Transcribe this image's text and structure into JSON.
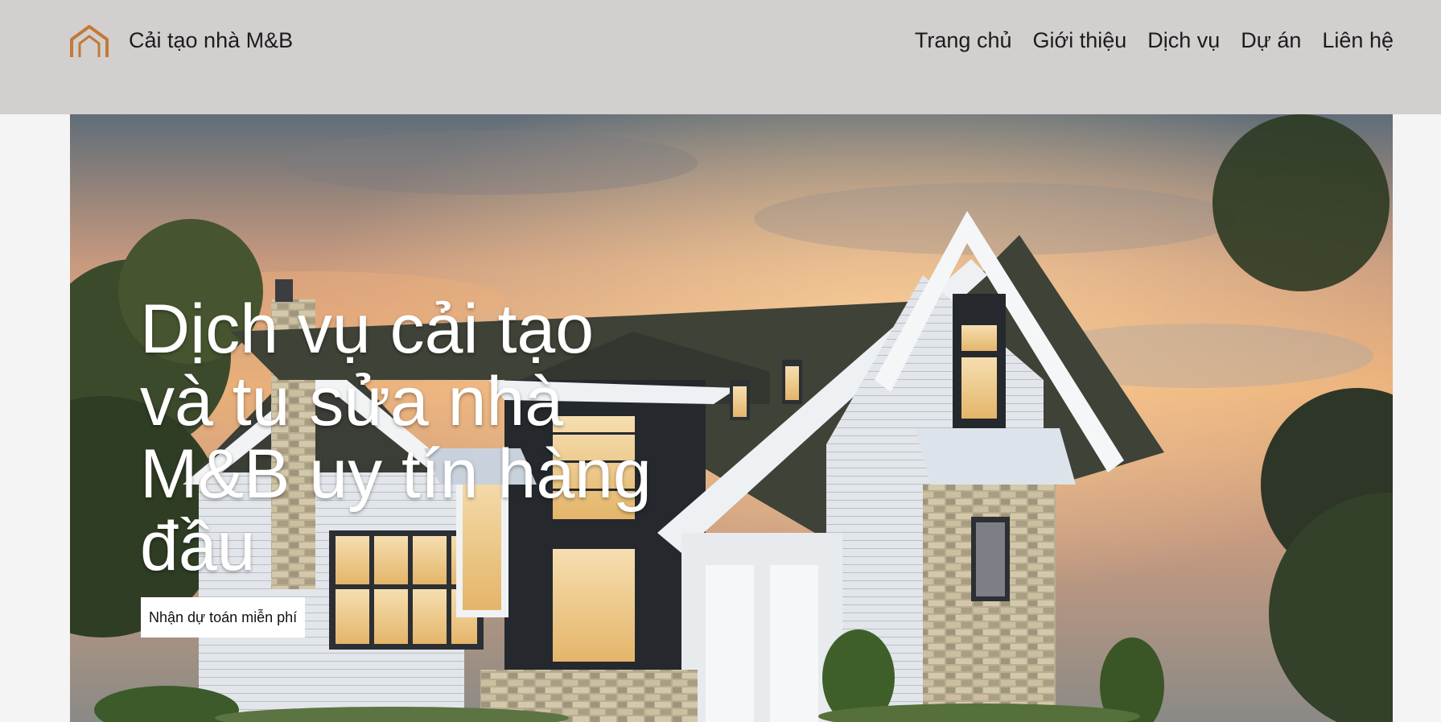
{
  "header": {
    "brand": "Cải tạo nhà M&B",
    "logo_icon": "house-outline-icon",
    "logo_color": "#c27a37",
    "nav": [
      {
        "label": "Trang chủ"
      },
      {
        "label": "Giới thiệu"
      },
      {
        "label": "Dịch vụ"
      },
      {
        "label": "Dự án"
      },
      {
        "label": "Liên hệ"
      }
    ]
  },
  "hero": {
    "title": "Dịch vụ cải tạo và tu sửa nhà M&B uy tín hàng đầu",
    "cta_label": "Nhận dự toán miễn phí",
    "background": "house-photo-at-sunset"
  }
}
